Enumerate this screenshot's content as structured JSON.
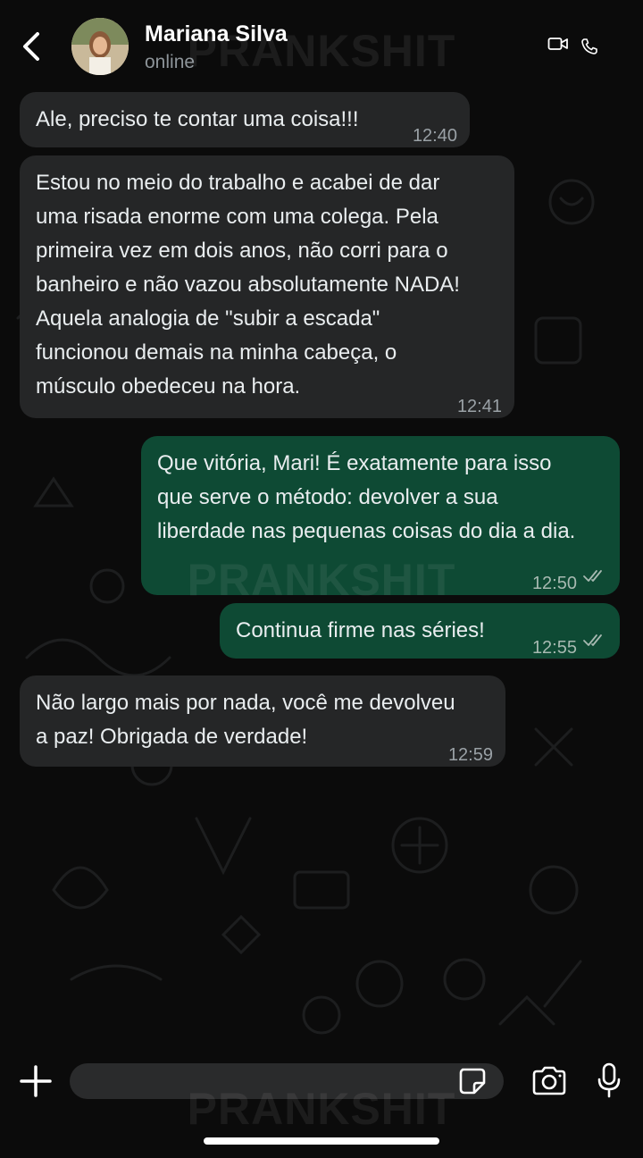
{
  "header": {
    "contact_name": "Mariana Silva",
    "status": "online"
  },
  "watermark": "PRANKSHIT",
  "messages": [
    {
      "direction": "in",
      "text": "Ale, preciso te contar uma coisa!!!",
      "time": "12:40"
    },
    {
      "direction": "in",
      "text": "Estou no meio do trabalho e acabei de dar\numa risada enorme com uma colega. Pela\nprimeira vez em dois anos, não corri para o\nbanheiro e não vazou absolutamente NADA!\nAquela analogia de \"subir a escada\"\nfuncionou demais na minha cabeça, o\nmúsculo obedeceu na hora.",
      "time": "12:41"
    },
    {
      "direction": "out",
      "text": "Que vitória, Mari! É exatamente para isso\nque serve o método: devolver a sua\nliberdade nas pequenas coisas do dia a dia.",
      "time": "12:50",
      "status": "read"
    },
    {
      "direction": "out",
      "text": "Continua firme nas séries!",
      "time": "12:55",
      "status": "read"
    },
    {
      "direction": "in",
      "text": "Não largo mais por nada, você me devolveu\na paz! Obrigada de verdade!",
      "time": "12:59"
    }
  ],
  "icons": {
    "back": "chevron-left-icon",
    "video": "video-camera-icon",
    "call": "phone-icon",
    "attach": "plus-icon",
    "sticker": "sticker-icon",
    "camera": "camera-icon",
    "mic": "microphone-icon"
  },
  "colors": {
    "incoming_bubble": "#252627",
    "outgoing_bubble": "#0e4a34",
    "background": "#0b0b0b",
    "read_ticks": "#a7b9b1"
  }
}
